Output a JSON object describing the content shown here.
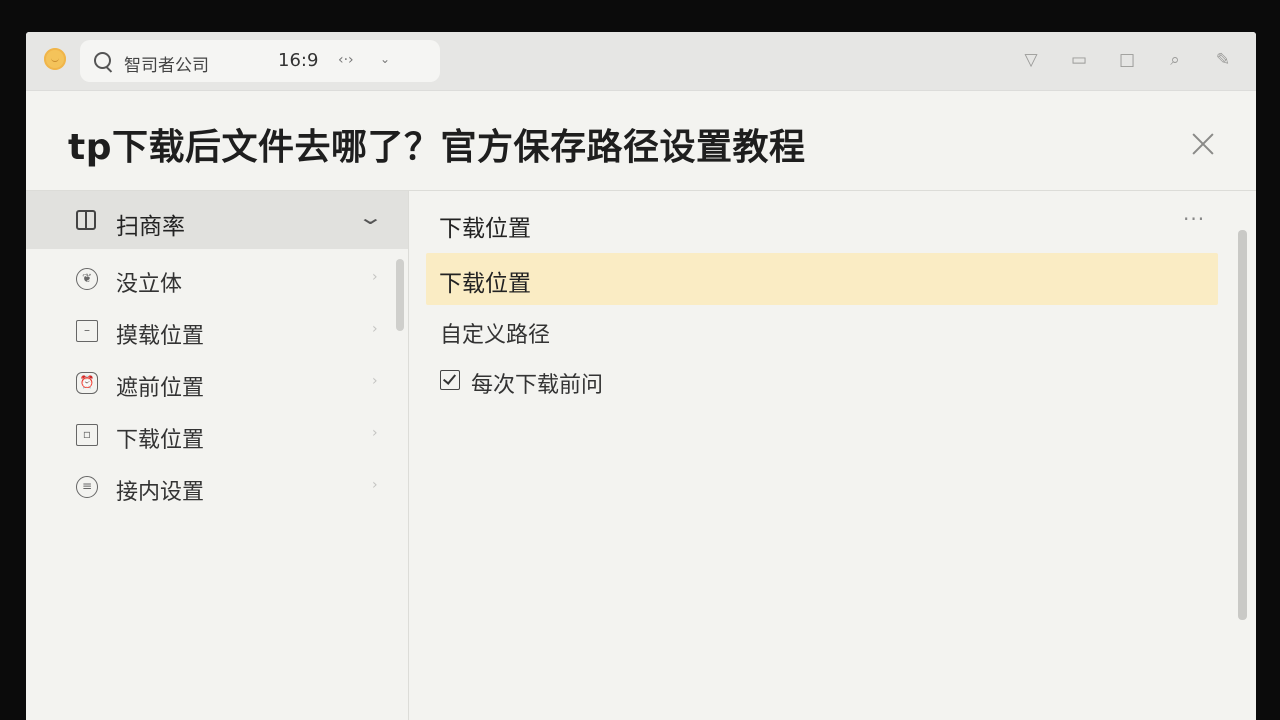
{
  "topbar": {
    "search_query": "智司者公司",
    "aspect_ratio": "16:9"
  },
  "dialog": {
    "title": "tp下载后文件去哪了？官方保存路径设置教程"
  },
  "sidebar": {
    "header_label": "扫商率",
    "items": [
      {
        "label": "没立体",
        "icon": "leaf-icon"
      },
      {
        "label": "摸载位置",
        "icon": "minus-box-icon"
      },
      {
        "label": "遮前位置",
        "icon": "alarm-icon"
      },
      {
        "label": "下载位置",
        "icon": "square-box-icon"
      },
      {
        "label": "接内设置",
        "icon": "list-circle-icon"
      }
    ]
  },
  "main": {
    "header": "下载位置",
    "selected_option": "下载位置",
    "custom_path_label": "自定义路径",
    "ask_each_time_label": "每次下载前问",
    "ask_each_time_checked": true
  }
}
